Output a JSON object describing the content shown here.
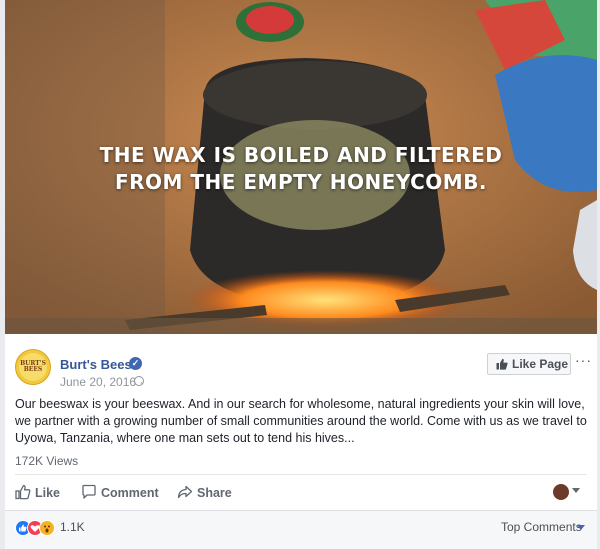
{
  "video": {
    "caption_line1": "THE WAX IS BOILED AND FILTERED",
    "caption_line2": "FROM THE EMPTY HONEYCOMB."
  },
  "post": {
    "page_name": "Burt's Bees",
    "date": "June 20, 2016 ·",
    "avatar_text_1": "BURT'S",
    "avatar_text_2": "BEES",
    "like_page_label": "Like Page",
    "more_label": "···",
    "body": "Our beeswax is your beeswax. And in our search for wholesome, natural ingredients your skin will love, we partner with a growing number of small communities around the world. Come with us as we travel to Uyowa, Tanzania, where one man sets out to tend his hives...",
    "views": "172K Views"
  },
  "actions": {
    "like": "Like",
    "comment": "Comment",
    "share": "Share"
  },
  "footer": {
    "reaction_count": "1.1K",
    "top_comments": "Top Comments"
  },
  "colors": {
    "link_blue": "#365899",
    "fb_blue": "#4267b2",
    "like_blue": "#2078f4",
    "love_red": "#f33e58",
    "wow_yellow": "#f7b125"
  },
  "icons": [
    "verified-icon",
    "globe-icon",
    "thumbs-up-icon",
    "comment-icon",
    "share-icon",
    "caret-down-icon",
    "like-reaction-icon",
    "love-reaction-icon",
    "wow-reaction-icon"
  ]
}
